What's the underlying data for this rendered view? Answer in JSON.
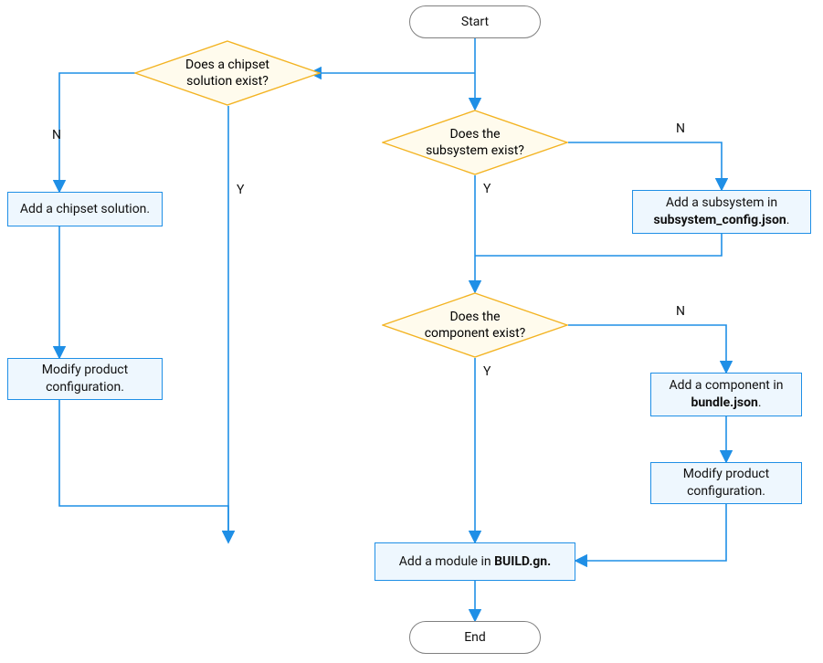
{
  "colors": {
    "blue": "#1f8fe6",
    "blueFill": "#eef7fe",
    "diamondStroke": "#f3b321",
    "diamondFill": "#fffbed",
    "gray": "#808080"
  },
  "nodes": {
    "start": "Start",
    "end": "End",
    "d_chipset": "Does a chipset\nsolution exist?",
    "d_subsystem": "Does the\nsubsystem exist?",
    "d_component": "Does the\ncomponent exist?",
    "p_add_chipset": "Add a chipset solution.",
    "p_mod_prod_left": "Modify product\nconfiguration.",
    "p_add_subsystem_pre": "Add a subsystem in",
    "p_add_subsystem_bold": "subsystem_config.json",
    "p_add_component_pre": "Add a component in",
    "p_add_component_bold": "bundle.json",
    "p_mod_prod_right": "Modify product\nconfiguration.",
    "p_add_module_pre": "Add a module in ",
    "p_add_module_bold": "BUILD.gn."
  },
  "labels": {
    "Y": "Y",
    "N": "N"
  }
}
